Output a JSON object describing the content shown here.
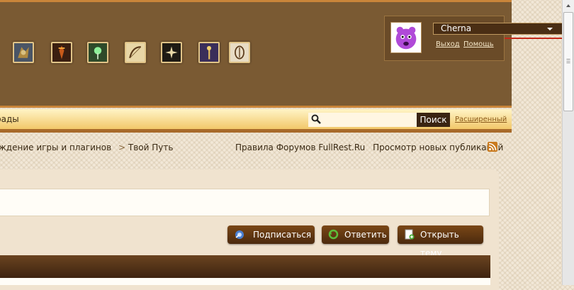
{
  "header": {
    "game_icons": [
      "warcraft-icon",
      "diablo-icon",
      "tree-icon",
      "bow-icon",
      "swirl-icon",
      "staff-icon",
      "oblivion-icon"
    ]
  },
  "user": {
    "name": "Cherna",
    "logout": "Выход",
    "help": "Помощь"
  },
  "navbar": {
    "partial_tab": "рады",
    "search_placeholder": "",
    "search_button": "Поиск",
    "advanced": "Расширенный"
  },
  "breadcrumb": {
    "item1": "ждение игры и плагинов",
    "separator": ">",
    "item2": "Твой Путь"
  },
  "top_links": {
    "rules": "Правила Форумов FullRest.Ru",
    "new_posts": "Просмотр новых публикаций"
  },
  "actions": {
    "subscribe": "Подписаться",
    "reply": "Ответить",
    "new_topic": "Открыть тему"
  },
  "colors": {
    "header_bg": "#7a5a33",
    "accent": "#c9853a",
    "button_bg": "#5e3812"
  }
}
